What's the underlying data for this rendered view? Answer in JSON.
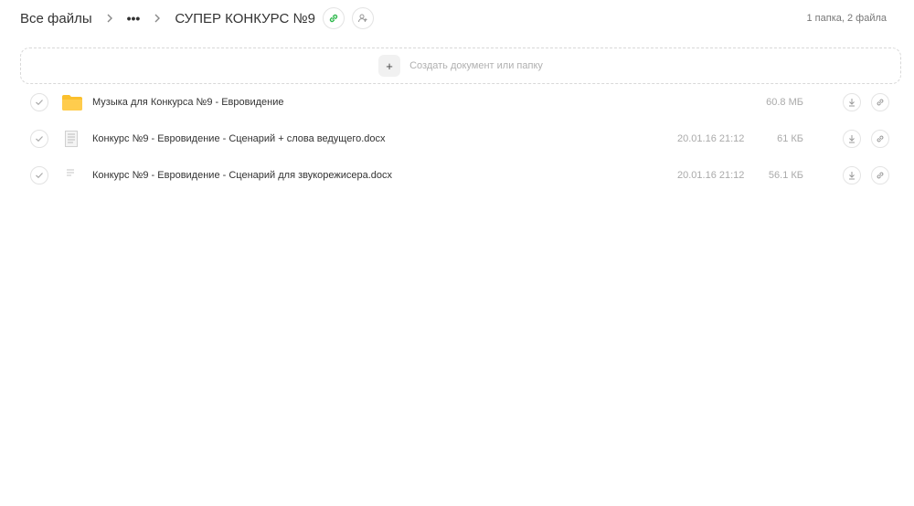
{
  "breadcrumb": {
    "root": "Все файлы",
    "ellipsis": "•••",
    "current": "СУПЕР КОНКУРС №9"
  },
  "summary": "1 папка, 2 файла",
  "create": {
    "plus": "+",
    "label": "Создать документ или папку"
  },
  "files": [
    {
      "name": "Музыка для Конкурса №9 - Евровидение",
      "date": "",
      "size": "60.8 МБ",
      "type": "folder-icon"
    },
    {
      "name": "Конкурс №9 - Евровидение - Сценарий + слова ведущего.docx",
      "date": "20.01.16 21:12",
      "size": "61 КБ",
      "type": "document-icon"
    },
    {
      "name": "Конкурс №9 - Евровидение - Сценарий для звукорежисера.docx",
      "date": "20.01.16 21:12",
      "size": "56.1 КБ",
      "type": "document-icon"
    }
  ],
  "colors": {
    "link_accent": "#2db84b",
    "folder": "#fbc02d"
  }
}
